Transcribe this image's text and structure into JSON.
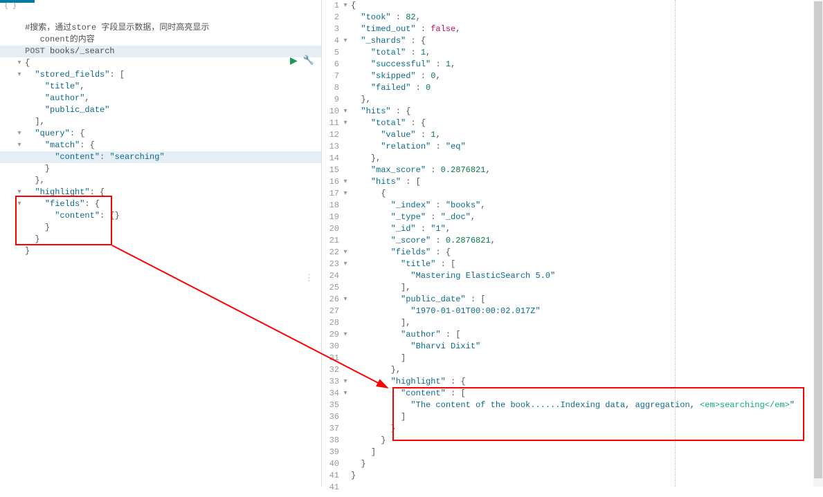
{
  "left": {
    "top_symbol": "{ }",
    "comment1": "#搜索，通过store 字段显示数据，同时高亮显示",
    "comment2": "   conent的内容",
    "method": "POST",
    "path": "books/_search",
    "body_lines": [
      "{",
      "  \"stored_fields\": [",
      "    \"title\",",
      "    \"author\",",
      "    \"public_date\"",
      "  ],",
      "  \"query\": {",
      "    \"match\": {",
      "      \"content\": \"searching\"",
      "    }",
      "  },",
      "  \"highlight\": {",
      "    \"fields\": {",
      "      \"content\": {}",
      "    }",
      "  }",
      "}"
    ]
  },
  "right": {
    "lines": [
      "{",
      "  \"took\" : 82,",
      "  \"timed_out\" : false,",
      "  \"_shards\" : {",
      "    \"total\" : 1,",
      "    \"successful\" : 1,",
      "    \"skipped\" : 0,",
      "    \"failed\" : 0",
      "  },",
      "  \"hits\" : {",
      "    \"total\" : {",
      "      \"value\" : 1,",
      "      \"relation\" : \"eq\"",
      "    },",
      "    \"max_score\" : 0.2876821,",
      "    \"hits\" : [",
      "      {",
      "        \"_index\" : \"books\",",
      "        \"_type\" : \"_doc\",",
      "        \"_id\" : \"1\",",
      "        \"_score\" : 0.2876821,",
      "        \"fields\" : {",
      "          \"title\" : [",
      "            \"Mastering ElasticSearch 5.0\"",
      "          ],",
      "          \"public_date\" : [",
      "            \"1970-01-01T00:00:02.017Z\"",
      "          ],",
      "          \"author\" : [",
      "            \"Bharvi Dixit\"",
      "          ]",
      "        },",
      "        \"highlight\" : {",
      "          \"content\" : [",
      "            \"The content of the book......Indexing data, aggregation, <em>searching</em>.",
      "          ]",
      "        }",
      "      }",
      "    ]",
      "  }",
      "}"
    ]
  },
  "icons": {
    "play": "▶",
    "wrench": "🔧",
    "drag": "⋮"
  }
}
